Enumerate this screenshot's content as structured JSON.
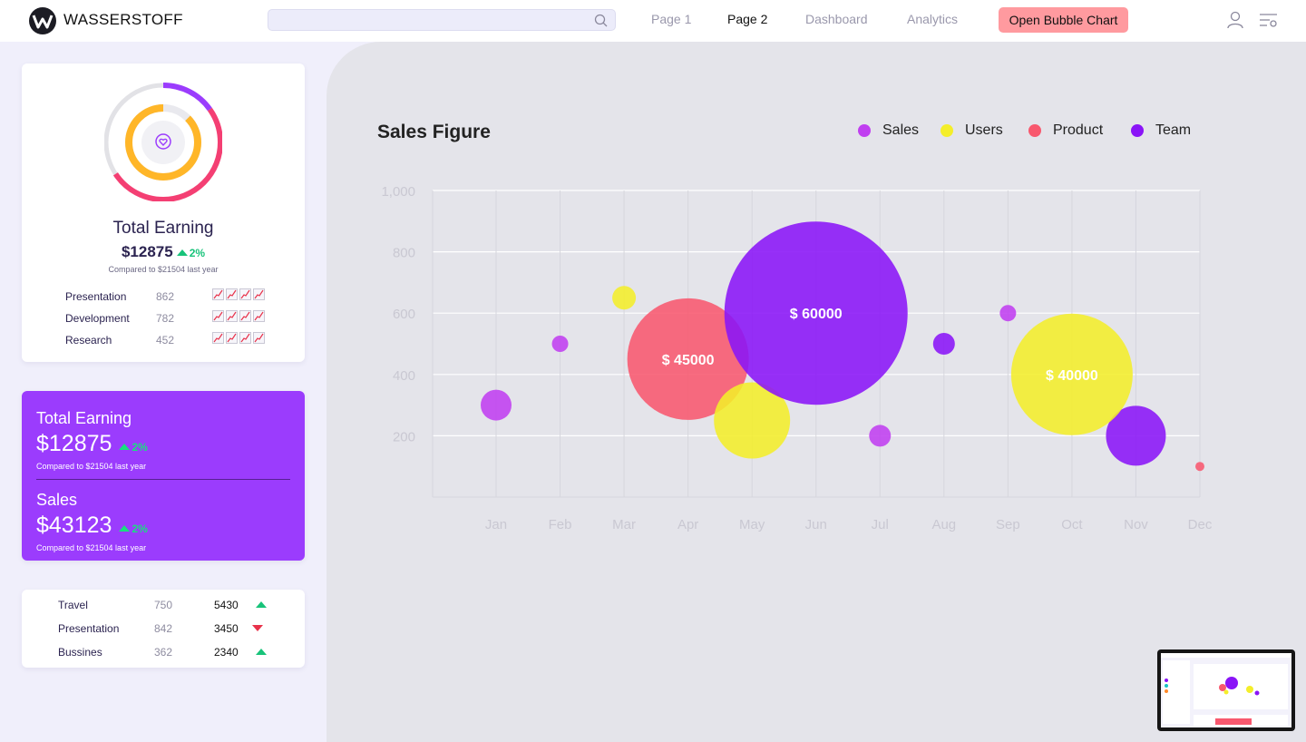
{
  "header": {
    "brand": "WASSERSTOFF",
    "search_placeholder": "",
    "nav": [
      {
        "label": "Page 1",
        "active": false
      },
      {
        "label": "Page 2",
        "active": true
      },
      {
        "label": "Dashboard",
        "active": false
      },
      {
        "label": "Analytics",
        "active": false
      }
    ],
    "cta_label": "Open Bubble Chart",
    "icons": [
      "user-icon",
      "settings-filter-icon"
    ]
  },
  "earning_card": {
    "title": "Total Earning",
    "amount": "$12875",
    "change": "2%",
    "compare": "Compared to $21504 last year",
    "rows": [
      {
        "label": "Presentation",
        "value": "862"
      },
      {
        "label": "Development",
        "value": "782"
      },
      {
        "label": "Research",
        "value": "452"
      }
    ]
  },
  "summary_card": {
    "earning_title": "Total Earning",
    "earning_amount": "$12875",
    "earning_change": "2%",
    "earning_compare": "Compared to $21504 last year",
    "sales_title": "Sales",
    "sales_amount": "$43123",
    "sales_change": "2%",
    "sales_compare": "Compared to $21504 last year",
    "color": "#9b3cfd"
  },
  "category_table": {
    "rows": [
      {
        "label": "Travel",
        "count": "750",
        "value": "5430",
        "trend": "up"
      },
      {
        "label": "Presentation",
        "count": "842",
        "value": "3450",
        "trend": "down"
      },
      {
        "label": "Bussines",
        "count": "362",
        "value": "2340",
        "trend": "up"
      }
    ]
  },
  "chart_data": {
    "type": "scatter",
    "title": "Sales Figure",
    "categories": [
      "Jan",
      "Feb",
      "Mar",
      "Apr",
      "May",
      "Jun",
      "Jul",
      "Aug",
      "Sep",
      "Oct",
      "Nov",
      "Dec"
    ],
    "y_ticks": [
      "1,000",
      "800",
      "600",
      "400",
      "200"
    ],
    "ylim": [
      0,
      1000
    ],
    "grid": true,
    "legend_position": "top-right",
    "series": [
      {
        "name": "Sales",
        "color": "#c03ff0",
        "points": [
          {
            "x": "Jan",
            "y": 300,
            "r": 17
          },
          {
            "x": "Feb",
            "y": 500,
            "r": 9
          },
          {
            "x": "Jul",
            "y": 200,
            "r": 12
          },
          {
            "x": "Sep",
            "y": 600,
            "r": 9
          }
        ]
      },
      {
        "name": "Users",
        "color": "#f4ee2a",
        "points": [
          {
            "x": "Mar",
            "y": 650,
            "r": 13
          },
          {
            "x": "May",
            "y": 250,
            "r": 42
          },
          {
            "x": "Oct",
            "y": 400,
            "r": 67,
            "label": "$ 40000"
          }
        ]
      },
      {
        "name": "Product",
        "color": "#f8586e",
        "points": [
          {
            "x": "Apr",
            "y": 450,
            "r": 67,
            "label": "$ 45000"
          },
          {
            "x": "Dec",
            "y": 100,
            "r": 5
          }
        ]
      },
      {
        "name": "Team",
        "color": "#8a14f7",
        "points": [
          {
            "x": "Jun",
            "y": 600,
            "r": 101,
            "label": "$ 60000"
          },
          {
            "x": "Aug",
            "y": 500,
            "r": 12
          },
          {
            "x": "Nov",
            "y": 200,
            "r": 33
          }
        ]
      }
    ]
  }
}
